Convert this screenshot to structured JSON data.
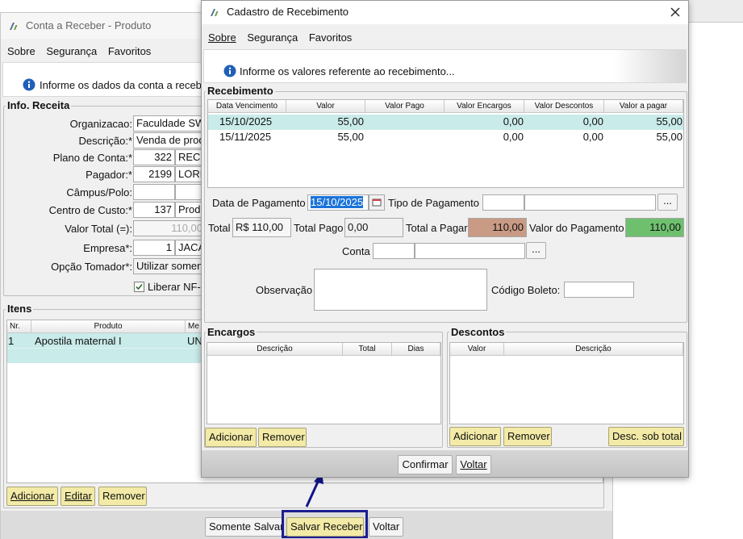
{
  "bg_window": {
    "title": "Conta a Receber - Produto",
    "menu": [
      "Sobre",
      "Segurança",
      "Favoritos"
    ],
    "info_text": "Informe os dados da conta a receb",
    "section_info": "Info. Receita",
    "fields": [
      {
        "label": "Organizacao:",
        "value1": "Faculdade SW",
        "value2": ""
      },
      {
        "label": "Descrição:*",
        "value1": "Venda de prod",
        "value2": ""
      },
      {
        "label": "Plano de Conta:*",
        "value1": "322",
        "value2": "RECE"
      },
      {
        "label": "Pagador:*",
        "value1": "2199",
        "value2": "LORE"
      },
      {
        "label": "Câmpus/Polo:",
        "value1": "",
        "value2": ""
      },
      {
        "label": "Centro de Custo:*",
        "value1": "137",
        "value2": "Prod"
      },
      {
        "label": "Valor Total (=):",
        "value1": "110,00",
        "value2": ""
      },
      {
        "label": "Empresa*:",
        "value1": "1",
        "value2": "JACA"
      },
      {
        "label": "Opção Tomador*:",
        "value1": "Utilizar somen",
        "value2": ""
      }
    ],
    "checkbox_label": "Liberar NF-",
    "section_itens": "Itens",
    "items_headers": [
      "Nr.",
      "Produto",
      "Me"
    ],
    "items_rows": [
      {
        "nr": "1",
        "produto": "Apostila maternal I",
        "me": "UN"
      }
    ],
    "items_buttons": [
      "Adicionar",
      "Editar",
      "Remover"
    ],
    "footer_buttons": {
      "somente_salvar": "Somente Salvar",
      "salvar_receber": "Salvar Receber",
      "voltar": "Voltar"
    }
  },
  "dialog": {
    "title": "Cadastro de Recebimento",
    "menu": [
      "Sobre",
      "Segurança",
      "Favoritos"
    ],
    "info_text": "Informe os valores referente ao recebimento...",
    "section_recebimento": "Recebimento",
    "table_headers": [
      "Data Vencimento",
      "Valor",
      "Valor Pago",
      "Valor Encargos",
      "Valor Descontos",
      "Valor a pagar"
    ],
    "table_rows": [
      {
        "data": "15/10/2025",
        "valor": "55,00",
        "pago": "",
        "encargos": "0,00",
        "descontos": "0,00",
        "apagar": "55,00"
      },
      {
        "data": "15/11/2025",
        "valor": "55,00",
        "pago": "",
        "encargos": "0,00",
        "descontos": "0,00",
        "apagar": "55,00"
      }
    ],
    "data_pagamento_label": "Data de Pagamento",
    "data_pagamento_value": "15/10/2025",
    "tipo_pagamento_label": "Tipo de Pagamento",
    "total_label": "Total",
    "total_value": "R$ 110,00",
    "total_pago_label": "Total Pago",
    "total_pago_value": "0,00",
    "total_a_pagar_label": "Total a Pagar",
    "total_a_pagar_value": "110,00",
    "valor_pagamento_label": "Valor do Pagamento",
    "valor_pagamento_value": "110,00",
    "conta_label": "Conta",
    "observacao_label": "Observação",
    "codigo_boleto_label": "Código Boleto:",
    "encargos_title": "Encargos",
    "encargos_headers": [
      "Descrição",
      "Total",
      "Dias"
    ],
    "descontos_title": "Descontos",
    "descontos_headers": [
      "Valor",
      "Descrição"
    ],
    "btn_adicionar": "Adicionar",
    "btn_remover": "Remover",
    "btn_desc_sob_total": "Desc. sob total",
    "btn_confirmar": "Confirmar",
    "btn_voltar": "Voltar",
    "ellipsis": "..."
  },
  "colors": {
    "selected_row": "#c9ebe9",
    "total_a_pagar_bg": "#c99a84",
    "valor_pagamento_bg": "#6ec06e",
    "highlight_border": "#1d1d8f",
    "arrow": "#14148a",
    "button_yellow": "#f2eaa6"
  }
}
